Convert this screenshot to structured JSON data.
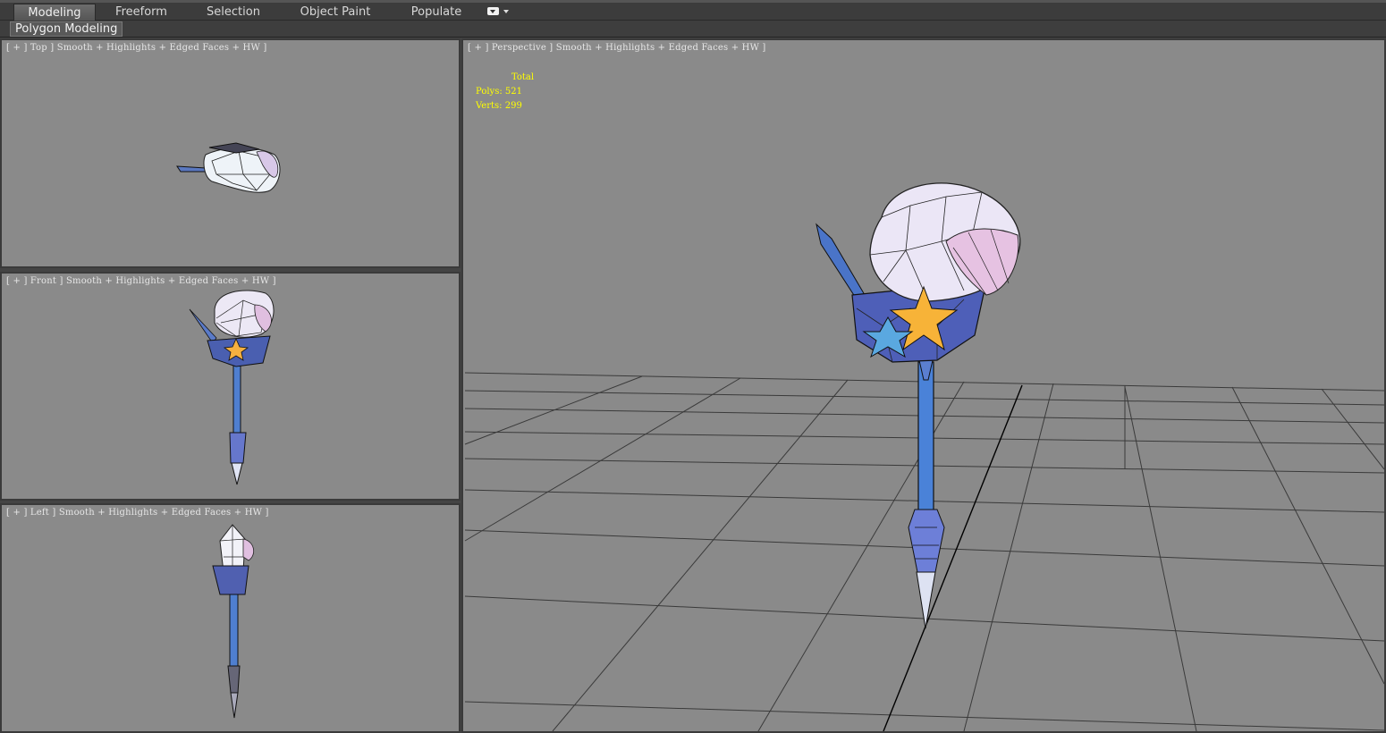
{
  "ribbon": {
    "tabs": [
      {
        "label": "Modeling",
        "active": true
      },
      {
        "label": "Freeform",
        "active": false
      },
      {
        "label": "Selection",
        "active": false
      },
      {
        "label": "Object Paint",
        "active": false
      },
      {
        "label": "Populate",
        "active": false
      }
    ],
    "panel_label": "Polygon Modeling",
    "toggle_icon": "ribbon-minimize-icon"
  },
  "viewports": {
    "top": {
      "label": "[ + ] Top ] Smooth + Highlights + Edged Faces + HW ]"
    },
    "front": {
      "label": "[ + ] Front ] Smooth + Highlights + Edged Faces + HW ]"
    },
    "left": {
      "label": "[ + ] Left ] Smooth + Highlights + Edged Faces + HW ]"
    },
    "perspective": {
      "label": "[ + ] Perspective ] Smooth + Highlights + Edged Faces + HW ]",
      "stats": {
        "header": "Total",
        "polys_label": "Polys:",
        "polys_value": "521",
        "verts_label": "Verts:",
        "verts_value": "299"
      }
    }
  },
  "colors": {
    "viewport_bg": "#8a8a8a",
    "stats_text": "#ffff00",
    "ui_bg": "#444444"
  }
}
